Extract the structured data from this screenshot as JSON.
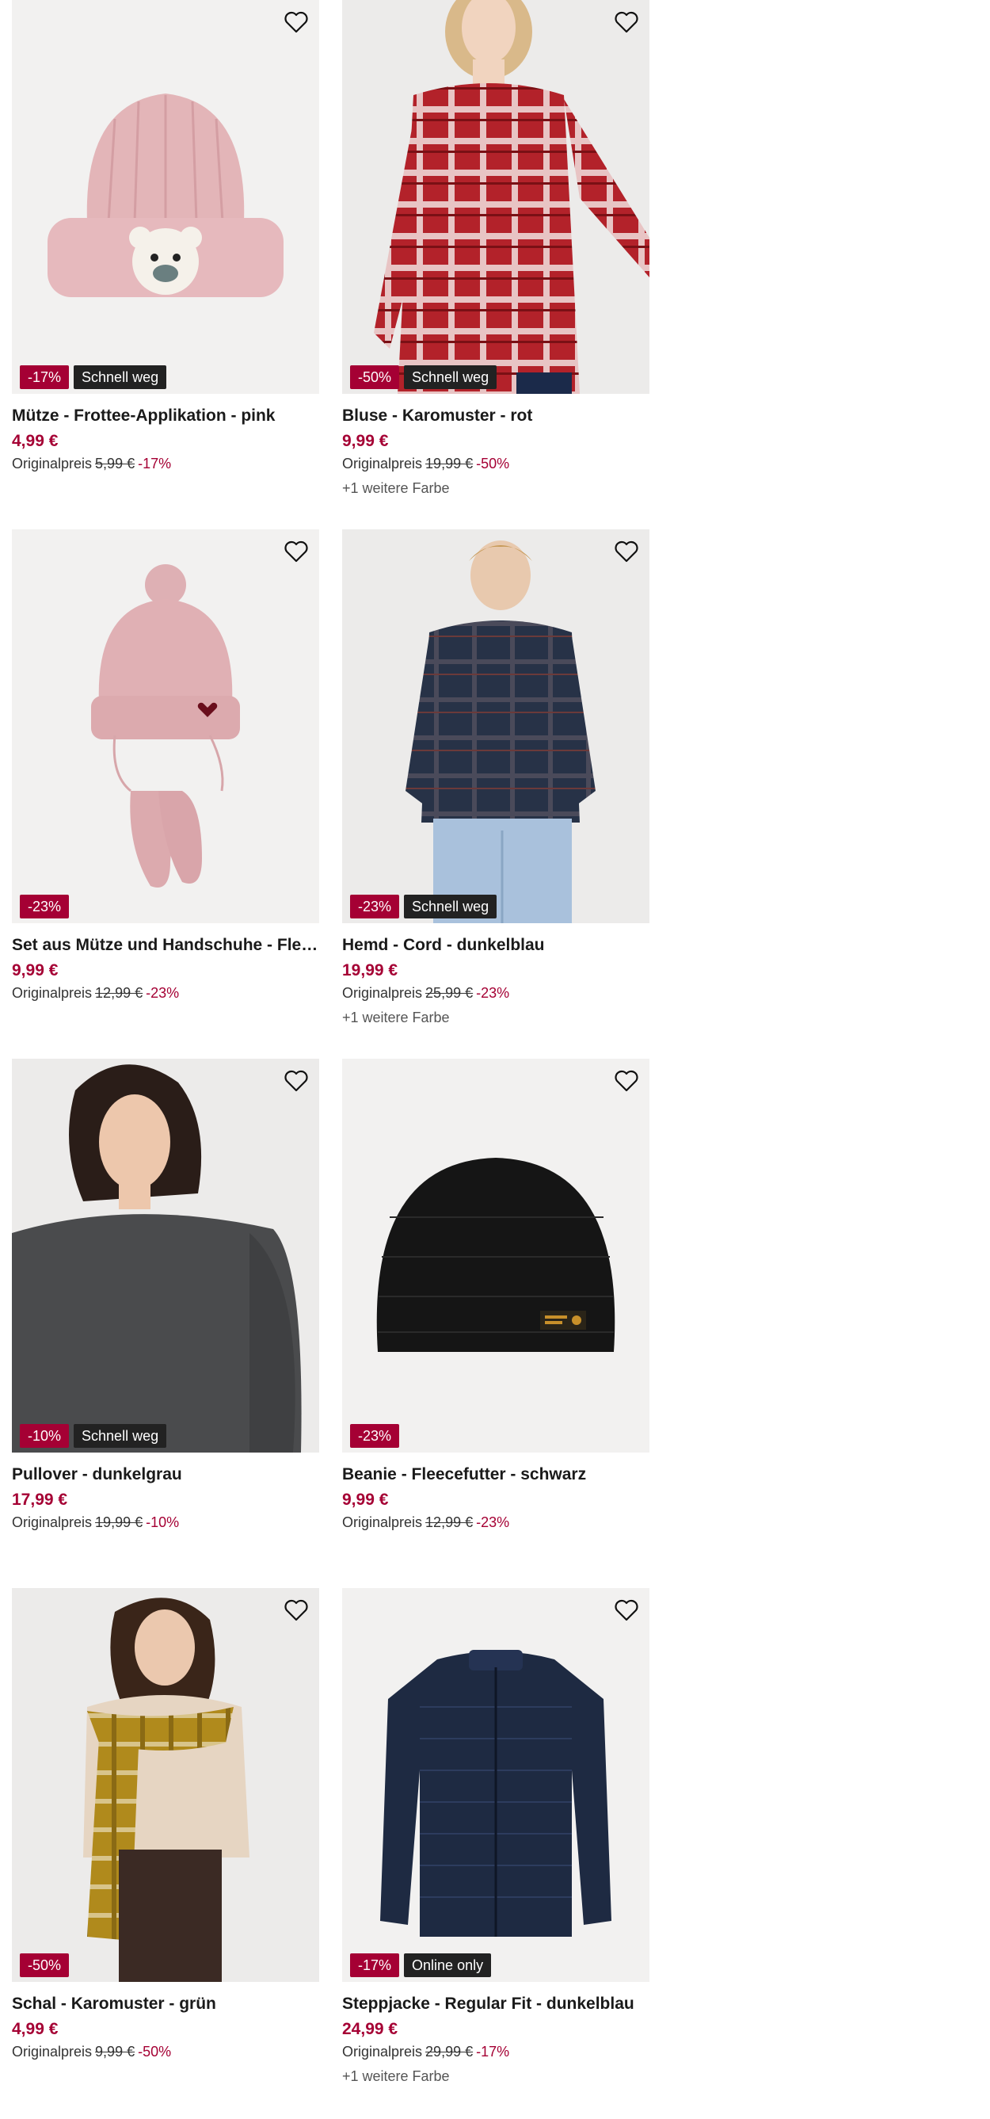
{
  "products": [
    {
      "title": "Mütze - Frottee-Applikation - pink",
      "price": "4,99 €",
      "orig_label": "Originalpreis",
      "orig_price": "5,99 €",
      "discount": "-17%",
      "badge_sale": "-17%",
      "badge_extra": "Schnell weg",
      "more": ""
    },
    {
      "title": "Bluse - Karomuster - rot",
      "price": "9,99 €",
      "orig_label": "Originalpreis",
      "orig_price": "19,99 €",
      "discount": "-50%",
      "badge_sale": "-50%",
      "badge_extra": "Schnell weg",
      "more": "+1 weitere Farbe"
    },
    {
      "title": "Set aus Mütze und Handschuhe - Fleecef...",
      "price": "9,99 €",
      "orig_label": "Originalpreis",
      "orig_price": "12,99 €",
      "discount": "-23%",
      "badge_sale": "-23%",
      "badge_extra": "",
      "more": ""
    },
    {
      "title": "Hemd - Cord - dunkelblau",
      "price": "19,99 €",
      "orig_label": "Originalpreis",
      "orig_price": "25,99 €",
      "discount": "-23%",
      "badge_sale": "-23%",
      "badge_extra": "Schnell weg",
      "more": "+1 weitere Farbe"
    },
    {
      "title": "Pullover - dunkelgrau",
      "price": "17,99 €",
      "orig_label": "Originalpreis",
      "orig_price": "19,99 €",
      "discount": "-10%",
      "badge_sale": "-10%",
      "badge_extra": "Schnell weg",
      "more": ""
    },
    {
      "title": "Beanie - Fleecefutter - schwarz",
      "price": "9,99 €",
      "orig_label": "Originalpreis",
      "orig_price": "12,99 €",
      "discount": "-23%",
      "badge_sale": "-23%",
      "badge_extra": "",
      "more": ""
    },
    {
      "title": "Schal - Karomuster - grün",
      "price": "4,99 €",
      "orig_label": "Originalpreis",
      "orig_price": "9,99 €",
      "discount": "-50%",
      "badge_sale": "-50%",
      "badge_extra": "",
      "more": ""
    },
    {
      "title": "Steppjacke - Regular Fit - dunkelblau",
      "price": "24,99 €",
      "orig_label": "Originalpreis",
      "orig_price": "29,99 €",
      "discount": "-17%",
      "badge_sale": "-17%",
      "badge_extra": "Online only",
      "more": "+1 weitere Farbe"
    }
  ],
  "icons": {
    "wishlist": "heart-outline-icon"
  },
  "colors": {
    "sale": "#a50034",
    "dark_badge": "#222222",
    "image_bg": "#f3f3f3"
  }
}
